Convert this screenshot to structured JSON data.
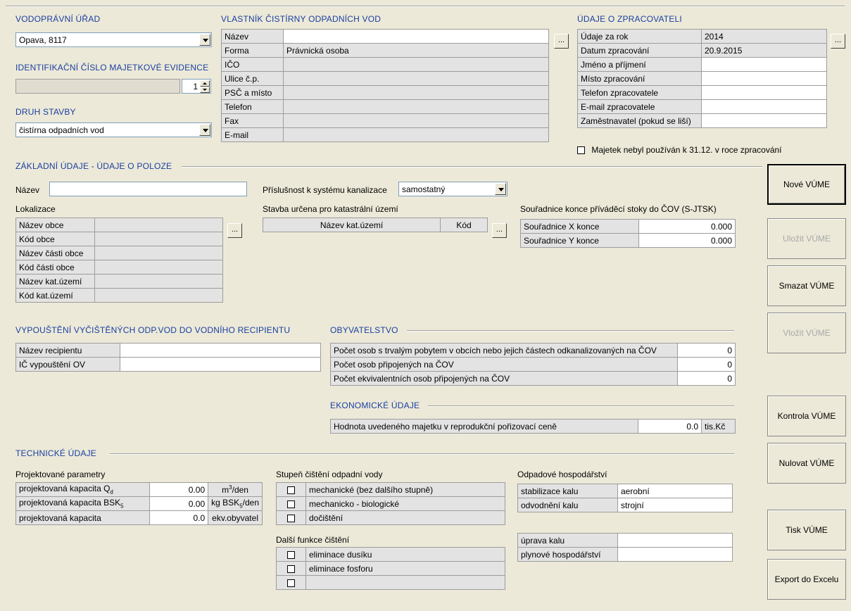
{
  "vodopravni": {
    "title": "VODOPRÁVNÍ ÚŘAD",
    "value": "Opava, 8117"
  },
  "identifikacni": {
    "title": "IDENTIFIKAČNÍ ČÍSLO MAJETKOVÉ EVIDENCE",
    "spinner_value": "1"
  },
  "druh": {
    "title": "DRUH STAVBY",
    "value": "čistírna odpadních vod"
  },
  "vlastnik": {
    "title": "VLASTNÍK ČISTÍRNY ODPADNÍCH VOD",
    "rows": [
      {
        "label": "Název",
        "value": ""
      },
      {
        "label": "Forma",
        "value": "Právnická osoba"
      },
      {
        "label": "IČO",
        "value": ""
      },
      {
        "label": "Ulice č.p.",
        "value": ""
      },
      {
        "label": "PSČ a místo",
        "value": ""
      },
      {
        "label": "Telefon",
        "value": ""
      },
      {
        "label": "Fax",
        "value": ""
      },
      {
        "label": "E-mail",
        "value": ""
      }
    ]
  },
  "zpracovatel": {
    "title": "ÚDAJE O ZPRACOVATELI",
    "rows": [
      {
        "label": "Údaje za rok",
        "value": "2014"
      },
      {
        "label": "Datum zpracování",
        "value": "20.9.2015"
      },
      {
        "label": "Jméno a příjmení",
        "value": ""
      },
      {
        "label": "Místo zpracování",
        "value": ""
      },
      {
        "label": "Telefon zpracovatele",
        "value": ""
      },
      {
        "label": "E-mail zpracovatele",
        "value": ""
      },
      {
        "label": "Zaměstnavatel (pokud se liší)",
        "value": ""
      }
    ],
    "checkbox_label": "Majetek nebyl používán k 31.12. v roce zpracování"
  },
  "dots": "...",
  "zakladni": {
    "title": "ZÁKLADNÍ ÚDAJE - ÚDAJE O POLOZE",
    "nazev_label": "Název",
    "nazev_value": "",
    "prislusnost_label": "Příslušnost k systému kanalizace",
    "prislusnost_value": "samostatný",
    "lokalizace_label": "Lokalizace",
    "lokalizace_rows": [
      {
        "label": "Název obce",
        "value": ""
      },
      {
        "label": "Kód obce",
        "value": ""
      },
      {
        "label": "Název části obce",
        "value": ""
      },
      {
        "label": "Kód části obce",
        "value": ""
      },
      {
        "label": "Název kat.území",
        "value": ""
      },
      {
        "label": "Kód kat.území",
        "value": ""
      }
    ],
    "stavba_label": "Stavba určena pro katastrální území",
    "stavba_headers": [
      "Název kat.území",
      "Kód"
    ],
    "souradnice_label": "Souřadnice konce příváděcí stoky do ČOV (S-JTSK)",
    "souradnice_rows": [
      {
        "label": "Souřadnice X konce",
        "value": "0.000"
      },
      {
        "label": "Souřadnice Y konce",
        "value": "0.000"
      }
    ]
  },
  "vypousteni": {
    "title": "VYPOUŠTĚNÍ VYČIŠTĚNÝCH ODP.VOD DO VODNÍHO RECIPIENTU",
    "rows": [
      {
        "label": "Název recipientu",
        "value": ""
      },
      {
        "label": "IČ vypouštění OV",
        "value": ""
      }
    ]
  },
  "obyvatelstvo": {
    "title": "OBYVATELSTVO",
    "rows": [
      {
        "label": "Počet osob s trvalým pobytem v obcích nebo jejich částech odkanalizovaných na ČOV",
        "value": "0"
      },
      {
        "label": "Počet osob připojených na ČOV",
        "value": "0"
      },
      {
        "label": "Počet ekvivalentních osob připojených na ČOV",
        "value": "0"
      }
    ]
  },
  "ekonomicke": {
    "title": "EKONOMICKÉ ÚDAJE",
    "label": "Hodnota uvedeného majetku v reprodukční pořizovací ceně",
    "value": "0.0",
    "unit": "tis.Kč"
  },
  "technicke": {
    "title": "TECHNICKÉ ÚDAJE",
    "projektovane_label": "Projektované parametry",
    "projektovane_rows": [
      {
        "label_pre": "projektovaná kapacita Q",
        "label_sub": "d",
        "value": "0.00",
        "unit_pre": "m",
        "unit_sup": "3",
        "unit_post": "/den"
      },
      {
        "label_pre": "projektovaná kapacita BSK",
        "label_sub": "5",
        "value": "0.00",
        "unit_pre": "kg BSK",
        "unit_sub": "5",
        "unit_post": "/den"
      },
      {
        "label_pre": "projektovaná kapacita",
        "label_sub": "",
        "value": "0.0",
        "unit_pre": "ekv.obyvatel",
        "unit_post": ""
      }
    ],
    "stupen_label": "Stupeň čištění odpadní vody",
    "stupen_rows": [
      "mechanické (bez dalšího stupně)",
      "mechanicko - biologické",
      "dočištění"
    ],
    "dalsi_label": "Další funkce čištění",
    "dalsi_rows": [
      "eliminace dusíku",
      "eliminace fosforu",
      ""
    ],
    "odpadove_label": "Odpadové hospodářství",
    "odpadove_rows": [
      {
        "label": "stabilizace kalu",
        "value": "aerobní"
      },
      {
        "label": "odvodnění kalu",
        "value": "strojní"
      }
    ],
    "uprava_rows": [
      {
        "label": "úprava kalu",
        "value": ""
      },
      {
        "label": "plynové hospodářství",
        "value": ""
      }
    ]
  },
  "buttons": {
    "nove": "Nové VÚME",
    "ulozit": "Uložit VÚME",
    "smazat": "Smazat VÚME",
    "vlozit": "Vložit VÚME",
    "kontrola": "Kontrola VÚME",
    "nulovat": "Nulovat VÚME",
    "tisk": "Tisk VÚME",
    "export": "Export do Excelu"
  }
}
